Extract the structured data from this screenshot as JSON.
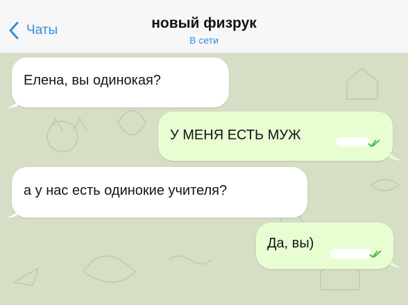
{
  "header": {
    "back_label": "Чаты",
    "title": "новый физрук",
    "status": "В сети"
  },
  "messages": [
    {
      "direction": "incoming",
      "text": "Елена, вы одинокая?"
    },
    {
      "direction": "outgoing",
      "text": "У МЕНЯ ЕСТЬ МУЖ"
    },
    {
      "direction": "incoming",
      "text": "а  у нас есть одинокие учителя?"
    },
    {
      "direction": "outgoing",
      "text": "Да, вы)"
    }
  ],
  "colors": {
    "accent": "#2f8ee0",
    "incoming_bubble": "#ffffff",
    "outgoing_bubble": "#e9fdd2",
    "chat_background": "#d6dec6",
    "read_ticks": "#4fba57"
  },
  "icons": {
    "back": "chevron-left-icon",
    "read": "double-check-icon"
  }
}
